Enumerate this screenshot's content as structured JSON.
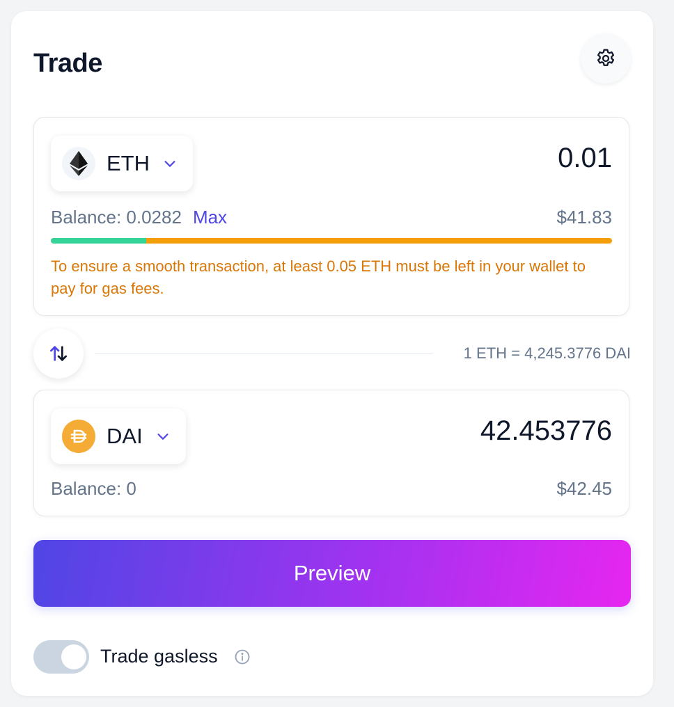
{
  "header": {
    "title": "Trade",
    "settings_icon": "gear-icon"
  },
  "from": {
    "token_symbol": "ETH",
    "token_icon": "ethereum-icon",
    "amount": "0.01",
    "balance_text": "Balance: 0.0282",
    "max_label": "Max",
    "usd_value": "$41.83",
    "gas_reserve_fraction": 0.17,
    "warning": "To ensure a smooth transaction, at least 0.05 ETH must be left in your wallet to pay for gas fees."
  },
  "swap": {
    "icon": "swap-arrows-icon",
    "rate_text": "1 ETH = 4,245.3776 DAI"
  },
  "to": {
    "token_symbol": "DAI",
    "token_icon": "dai-icon",
    "amount": "42.453776",
    "balance_text": "Balance: 0",
    "usd_value": "$42.45"
  },
  "actions": {
    "preview_label": "Preview"
  },
  "gasless": {
    "label": "Trade gasless",
    "enabled": false,
    "info_icon": "info-icon"
  },
  "colors": {
    "accent": "#4f46e5",
    "warning": "#d97706",
    "progress_ok": "#34d399",
    "progress_warn": "#f59e0b"
  }
}
